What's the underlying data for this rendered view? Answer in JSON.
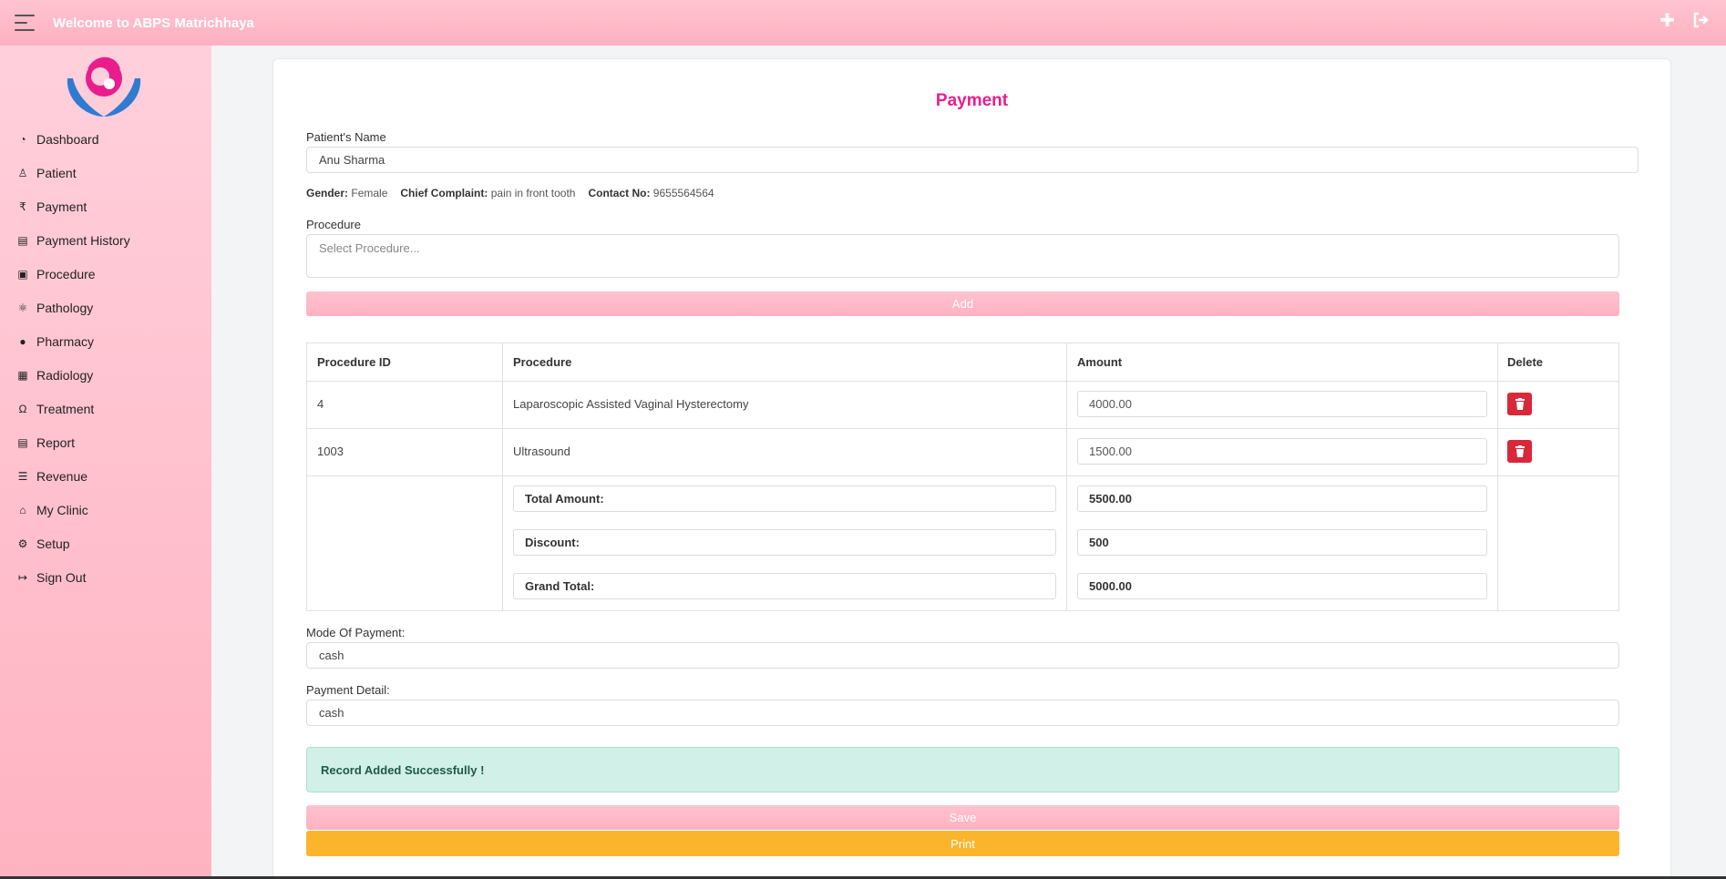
{
  "app": {
    "title": "Welcome to ABPS Matrichhaya"
  },
  "colors": {
    "accent": "#e91e8c",
    "brand_pink": "#ffb3c1",
    "danger": "#d9283a",
    "warning": "#fbb52c",
    "success_bg": "#d1f0e7"
  },
  "topbar": {
    "menu_icon": "hamburger-icon",
    "add_icon": "plus-icon",
    "exit_icon": "sign-out-icon"
  },
  "sidebar": {
    "items": [
      {
        "label": "Dashboard",
        "icon": "dashboard-icon"
      },
      {
        "label": "Patient",
        "icon": "patient-icon"
      },
      {
        "label": "Payment",
        "icon": "rupee-icon"
      },
      {
        "label": "Payment History",
        "icon": "document-icon"
      },
      {
        "label": "Procedure",
        "icon": "medkit-icon"
      },
      {
        "label": "Pathology",
        "icon": "microscope-icon"
      },
      {
        "label": "Pharmacy",
        "icon": "pills-icon"
      },
      {
        "label": "Radiology",
        "icon": "xray-icon"
      },
      {
        "label": "Treatment",
        "icon": "stethoscope-icon"
      },
      {
        "label": "Report",
        "icon": "report-icon"
      },
      {
        "label": "Revenue",
        "icon": "coins-icon"
      },
      {
        "label": "My Clinic",
        "icon": "home-icon"
      },
      {
        "label": "Setup",
        "icon": "gear-icon"
      },
      {
        "label": "Sign Out",
        "icon": "sign-out-icon"
      }
    ]
  },
  "form": {
    "title": "Payment",
    "patient_name_label": "Patient's Name",
    "patient_name_value": "Anu Sharma",
    "gender_label": "Gender:",
    "gender_value": "Female",
    "complaint_label": "Chief Complaint:",
    "complaint_value": "pain in front tooth",
    "contact_label": "Contact No:",
    "contact_value": "9655564564",
    "procedure_label": "Procedure",
    "procedure_placeholder": "Select Procedure...",
    "add_label": "Add",
    "mode_label": "Mode Of Payment:",
    "mode_value": "cash",
    "detail_label": "Payment Detail:",
    "detail_value": "cash",
    "alert": "Record Added Successfully !",
    "save_label": "Save",
    "print_label": "Print"
  },
  "table": {
    "headers": [
      "Procedure ID",
      "Procedure",
      "Amount",
      "Delete"
    ],
    "rows": [
      {
        "id": "4",
        "procedure": "Laparoscopic Assisted Vaginal Hysterectomy",
        "amount": "4000.00"
      },
      {
        "id": "1003",
        "procedure": "Ultrasound",
        "amount": "1500.00"
      }
    ],
    "totals": {
      "total_label": "Total Amount:",
      "total_value": "5500.00",
      "discount_label": "Discount:",
      "discount_value": "500",
      "grand_label": "Grand Total:",
      "grand_value": "5000.00"
    }
  }
}
